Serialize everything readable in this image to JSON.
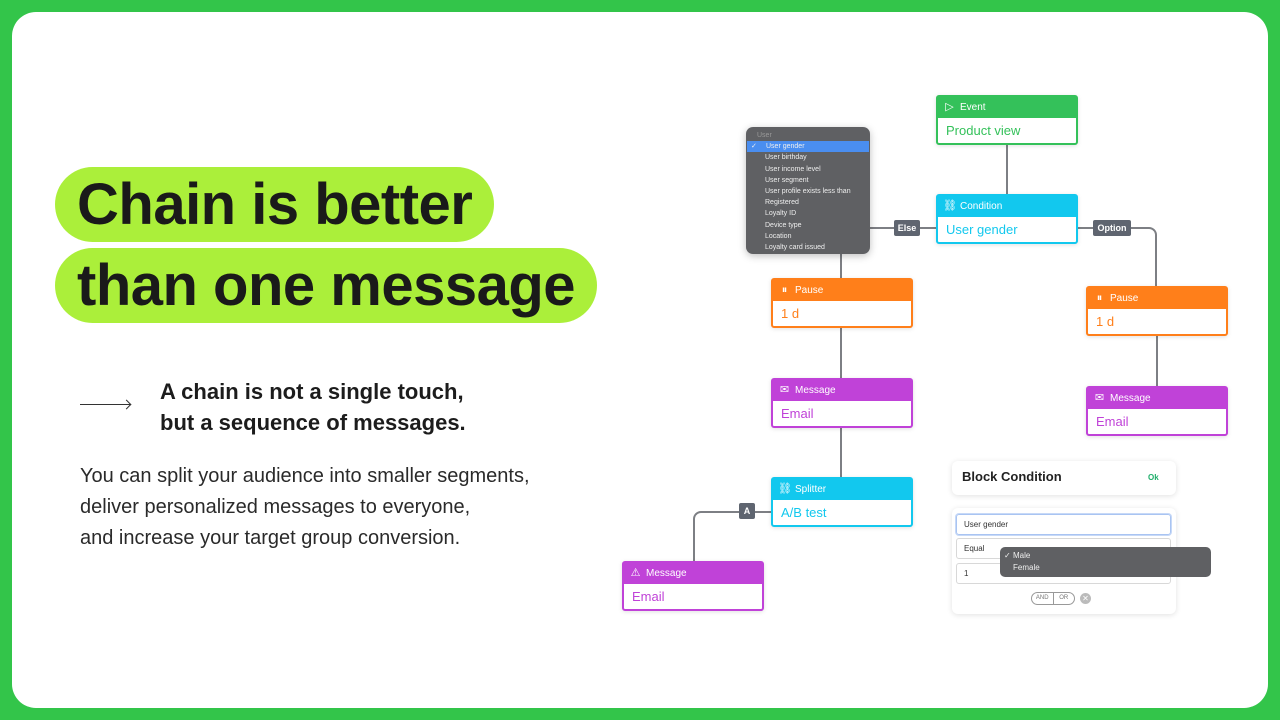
{
  "headline": {
    "line1": "Chain is better",
    "line2": "than one message"
  },
  "subheading": {
    "line1": "A chain is not a single touch,",
    "line2": "but a sequence of messages."
  },
  "paragraph": {
    "line1": "You can split your audience into smaller segments,",
    "line2": "deliver personalized messages to everyone,",
    "line3": "and increase your target group conversion."
  },
  "colors": {
    "background": "#33c54a",
    "highlight": "#abef3a",
    "event": "#34c15a",
    "condition": "#12c8ee",
    "pause": "#ff7f1a",
    "message": "#c042d8"
  },
  "nodes": {
    "event": {
      "type": "Event",
      "value": "Product view",
      "icon": "play-icon"
    },
    "condition": {
      "type": "Condition",
      "value": "User gender",
      "icon": "hierarchy-icon"
    },
    "pause_left": {
      "type": "Pause",
      "value": "1 d",
      "icon": "pause-icon"
    },
    "pause_right": {
      "type": "Pause",
      "value": "1 d",
      "icon": "pause-icon"
    },
    "message_left": {
      "type": "Message",
      "value": "Email",
      "icon": "envelope-icon"
    },
    "message_right": {
      "type": "Message",
      "value": "Email",
      "icon": "envelope-icon"
    },
    "splitter": {
      "type": "Splitter",
      "value": "A/B test",
      "icon": "hierarchy-icon"
    },
    "message_bottom": {
      "type": "Message",
      "value": "Email",
      "icon": "warning-icon"
    }
  },
  "labels": {
    "else": "Else",
    "option": "Option",
    "a": "A"
  },
  "user_dropdown": {
    "group": "User",
    "items": [
      "User gender",
      "User birthday",
      "User income level",
      "User segment",
      "User profile exists less than",
      "Registered",
      "Loyalty ID",
      "Device type",
      "Location",
      "Loyalty card issued"
    ],
    "selected": "User gender"
  },
  "block_condition": {
    "title": "Block Condition",
    "ok": "Ok",
    "field": "User gender",
    "operator": "Equal",
    "value": "1",
    "and": "AND",
    "or": "OR",
    "options": [
      "Male",
      "Female"
    ],
    "selected": "Male"
  }
}
